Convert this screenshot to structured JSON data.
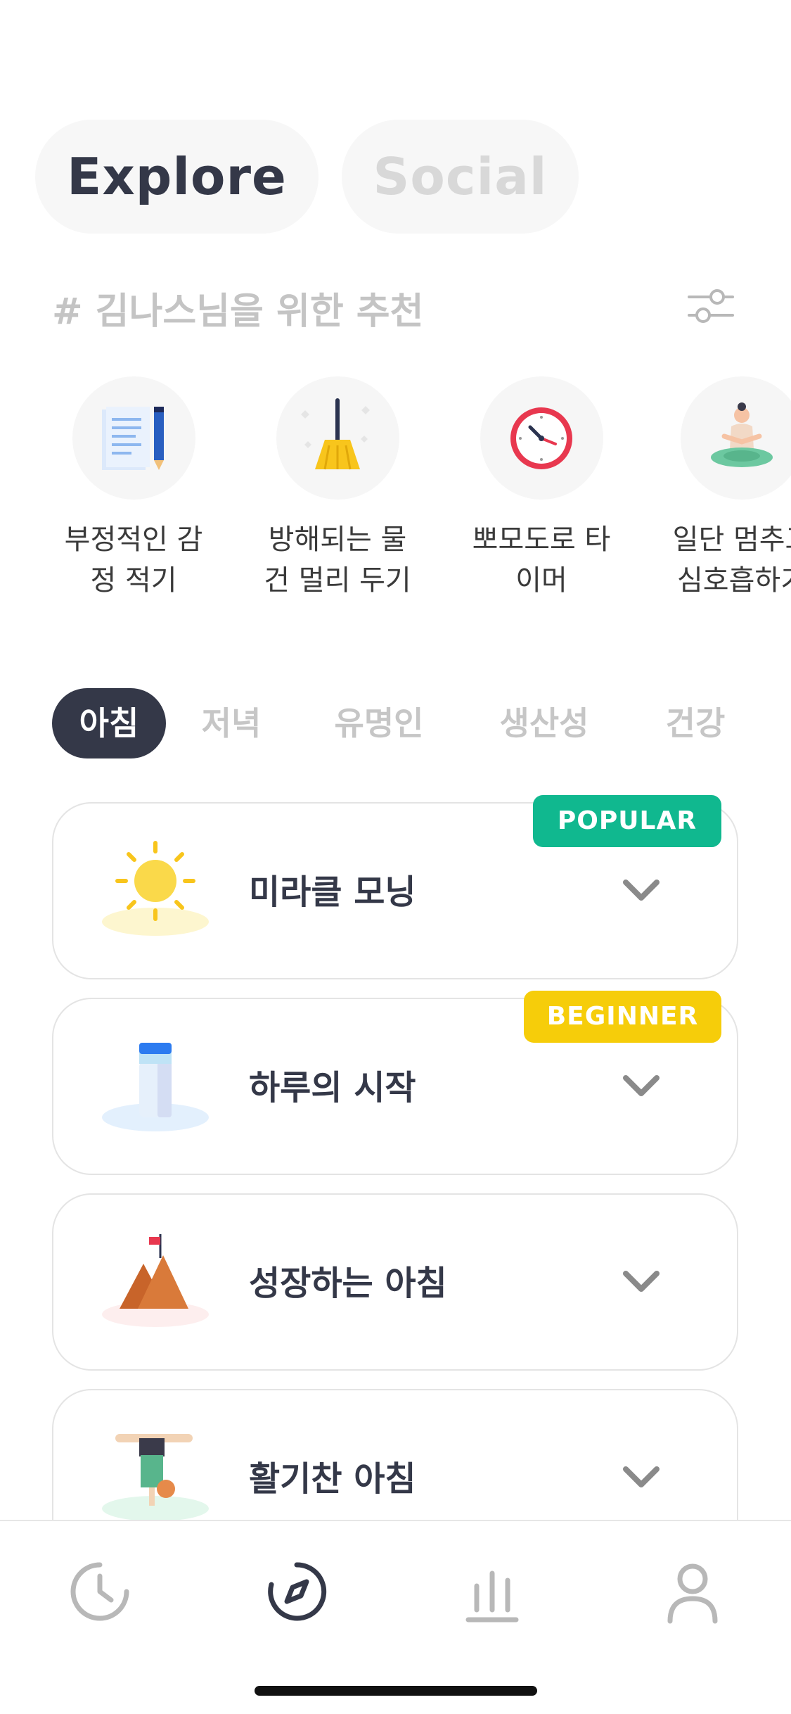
{
  "tabs": {
    "explore": "Explore",
    "social": "Social"
  },
  "recommendation": {
    "header": "# 김나스님을 위한 추천",
    "items": [
      {
        "label": "부정적인 감\n정 적기",
        "icon": "notebook-pencil-icon"
      },
      {
        "label": "방해되는 물\n건 멀리 두기",
        "icon": "broom-icon"
      },
      {
        "label": "뽀모도로 타\n이머",
        "icon": "clock-icon"
      },
      {
        "label": "일단 멈추고\n심호흡하기",
        "icon": "meditation-icon"
      }
    ]
  },
  "categories": [
    "아침",
    "저녁",
    "유명인",
    "생산성",
    "건강"
  ],
  "selected_category": "아침",
  "routines": [
    {
      "title": "미라클 모닝",
      "badge": "POPULAR",
      "badge_color": "#10b88f",
      "icon": "sun-icon"
    },
    {
      "title": "하루의 시작",
      "badge": "BEGINNER",
      "badge_color": "#f6cd0a",
      "icon": "water-bottle-icon"
    },
    {
      "title": "성장하는 아침",
      "badge": "",
      "icon": "mountain-flag-icon"
    },
    {
      "title": "활기찬 아침",
      "badge": "",
      "icon": "handstand-icon"
    }
  ],
  "bottom_nav": [
    "history-icon",
    "explore-icon",
    "stats-icon",
    "profile-icon"
  ],
  "active_nav": "explore-icon"
}
